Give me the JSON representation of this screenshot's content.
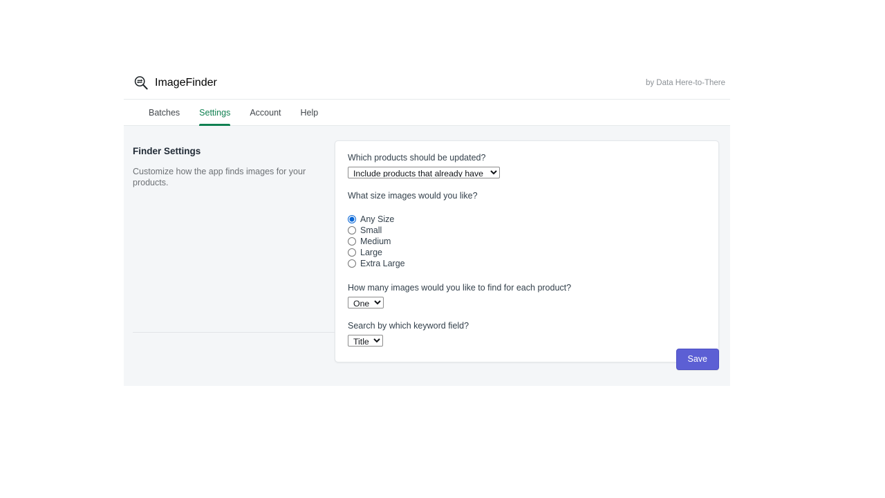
{
  "app": {
    "brand_name": "ImageFinder",
    "brand_icon": "magnifier-arrows-icon",
    "byline": "by Data Here-to-There"
  },
  "tabs": [
    {
      "label": "Batches",
      "active": false
    },
    {
      "label": "Settings",
      "active": true
    },
    {
      "label": "Account",
      "active": false
    },
    {
      "label": "Help",
      "active": false
    }
  ],
  "annotation": {
    "title": "Finder Settings",
    "description": "Customize how the app finds images for your products."
  },
  "form": {
    "products_question": "Which products should be updated?",
    "products_selected": "Include products that already have images",
    "products_options": [
      "Include products that already have images"
    ],
    "size_question": "What size images would you like?",
    "size_options": [
      {
        "label": "Any Size",
        "checked": true
      },
      {
        "label": "Small",
        "checked": false
      },
      {
        "label": "Medium",
        "checked": false
      },
      {
        "label": "Large",
        "checked": false
      },
      {
        "label": "Extra Large",
        "checked": false
      }
    ],
    "count_question": "How many images would you like to find for each product?",
    "count_selected": "One",
    "count_options": [
      "One"
    ],
    "keyword_question": "Search by which keyword field?",
    "keyword_selected": "Title",
    "keyword_options": [
      "Title"
    ]
  },
  "footer": {
    "save_label": "Save"
  },
  "colors": {
    "accent_green": "#108051",
    "save_purple": "#5c5fd4",
    "radio_blue": "#0a67d6",
    "content_bg": "#f4f6f8"
  }
}
